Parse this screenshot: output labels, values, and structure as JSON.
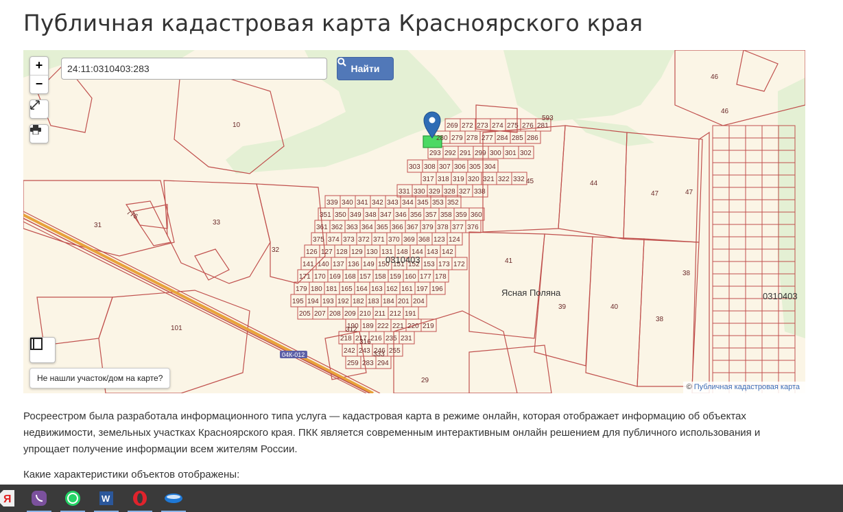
{
  "page": {
    "title": "Публичная кадастровая карта Красноярского края"
  },
  "map": {
    "search_value": "24:11:0310403:283",
    "search_button_label": "Найти",
    "not_found_label": "Не нашли участок/дом на карте?",
    "attribution_symbol": "©",
    "attribution_link": "Публичная кадастровая карта",
    "zoom_in_label": "+",
    "zoom_out_label": "−",
    "quarter_labels": [
      "0310403",
      "0310403"
    ],
    "place_name": "Ясная Поляна",
    "road_badge": "04К-012",
    "large_parcels": [
      "10",
      "31",
      "33",
      "32",
      "101",
      "776",
      "29",
      "45",
      "44",
      "47",
      "47",
      "46",
      "46",
      "41",
      "39",
      "40",
      "38",
      "38",
      "593"
    ],
    "small_parcels": [
      "269",
      "272",
      "273",
      "274",
      "275",
      "276",
      "281",
      "280",
      "279",
      "278",
      "277",
      "284",
      "285",
      "286",
      "293",
      "292",
      "291",
      "299",
      "300",
      "301",
      "302",
      "303",
      "308",
      "307",
      "306",
      "305",
      "304",
      "317",
      "318",
      "319",
      "320",
      "321",
      "322",
      "332",
      "331",
      "330",
      "329",
      "328",
      "327",
      "338",
      "339",
      "340",
      "341",
      "342",
      "343",
      "344",
      "345",
      "353",
      "352",
      "351",
      "350",
      "349",
      "348",
      "347",
      "346",
      "356",
      "357",
      "358",
      "359",
      "360",
      "361",
      "362",
      "363",
      "364",
      "365",
      "366",
      "367",
      "379",
      "378",
      "377",
      "376",
      "375",
      "374",
      "373",
      "372",
      "371",
      "370",
      "369",
      "368",
      "123",
      "124",
      "126",
      "127",
      "128",
      "129",
      "130",
      "131",
      "148",
      "144",
      "143",
      "142",
      "141",
      "140",
      "137",
      "136",
      "149",
      "150",
      "151",
      "152",
      "153",
      "173",
      "172",
      "171",
      "170",
      "169",
      "168",
      "157",
      "158",
      "159",
      "160",
      "177",
      "178",
      "179",
      "180",
      "181",
      "165",
      "164",
      "163",
      "162",
      "161",
      "197",
      "196",
      "195",
      "194",
      "193",
      "192",
      "182",
      "183",
      "184",
      "201",
      "204",
      "205",
      "207",
      "208",
      "209",
      "210",
      "211",
      "212",
      "191",
      "190",
      "189",
      "222",
      "221",
      "220",
      "219",
      "218",
      "217",
      "216",
      "235",
      "231",
      "242",
      "243",
      "246",
      "255",
      "259",
      "283",
      "294",
      "312",
      "316",
      "333"
    ],
    "icons": [
      "map-pin-icon",
      "search-icon",
      "fullscreen-icon",
      "print-icon",
      "legend-icon"
    ],
    "colors": {
      "parcel_border": "#c0504d",
      "parcel_fill": "#fbf5e6",
      "forest": "#e4f0d4",
      "selected_parcel": "#4cd964",
      "marker": "#2e6cb5",
      "button": "#5178b8"
    }
  },
  "content": {
    "description": "Росреестром была разработала информационного типа услуга — кадастровая карта в режиме онлайн, которая отображает информацию об объектах недвижимости, земельных участках Красноярского края. ПКК является современным интерактивным онлайн решением для публичного использования и упрощает получение информации всем жителям России.",
    "question": "Какие характеристики объектов отображены:"
  },
  "taskbar": {
    "items": [
      "yandex-browser-icon",
      "viber-icon",
      "whatsapp-icon",
      "word-icon",
      "opera-icon",
      "app-icon"
    ],
    "yandex_letter": "Я",
    "word_letter": "W"
  }
}
